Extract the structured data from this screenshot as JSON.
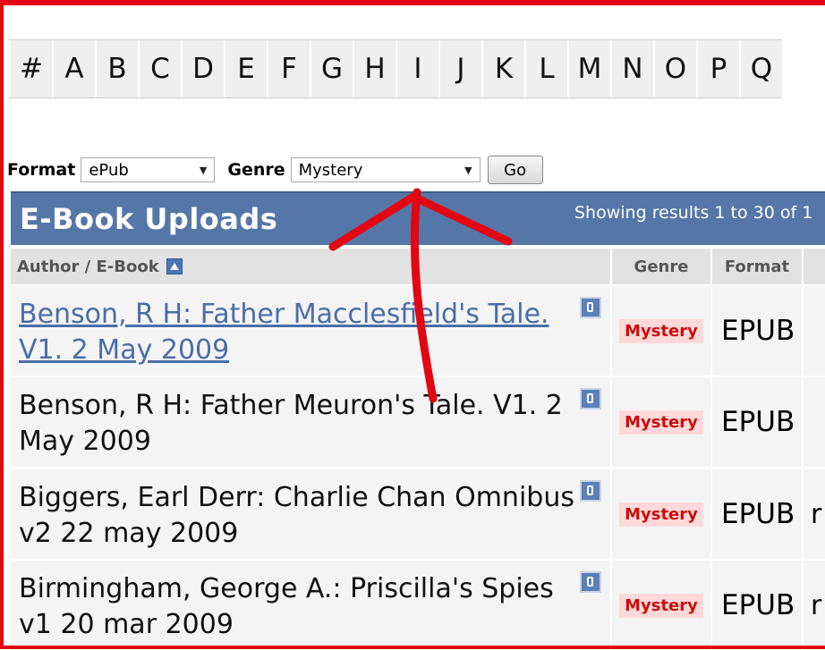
{
  "alphabet": [
    "#",
    "A",
    "B",
    "C",
    "D",
    "E",
    "F",
    "G",
    "H",
    "I",
    "J",
    "K",
    "L",
    "M",
    "N",
    "O",
    "P",
    "Q"
  ],
  "filters": {
    "format_label": "Format",
    "format_value": "ePub",
    "genre_label": "Genre",
    "genre_value": "Mystery",
    "go_label": "Go"
  },
  "header": {
    "title": "E-Book Uploads",
    "results_text": "Showing results 1 to 30 of 1"
  },
  "columns": {
    "author_ebook": "Author / E-Book",
    "genre": "Genre",
    "format": "Format"
  },
  "rows": [
    {
      "title": "Benson, R H: Father Macclesfield's Tale. V1. 2 May 2009",
      "genre": "Mystery",
      "format": "EPUB",
      "extra": "",
      "link": true
    },
    {
      "title": "Benson, R H: Father Meuron's Tale. V1. 2 May 2009",
      "genre": "Mystery",
      "format": "EPUB",
      "extra": "",
      "link": false
    },
    {
      "title": "Biggers, Earl Derr: Charlie Chan Omnibus v2 22 may 2009",
      "genre": "Mystery",
      "format": "EPUB",
      "extra": "r",
      "link": false
    },
    {
      "title": "Birmingham, George A.: Priscilla's Spies v1 20 mar 2009",
      "genre": "Mystery",
      "format": "EPUB",
      "extra": "r",
      "link": false
    }
  ],
  "annotation": {
    "color": "#e30613"
  }
}
